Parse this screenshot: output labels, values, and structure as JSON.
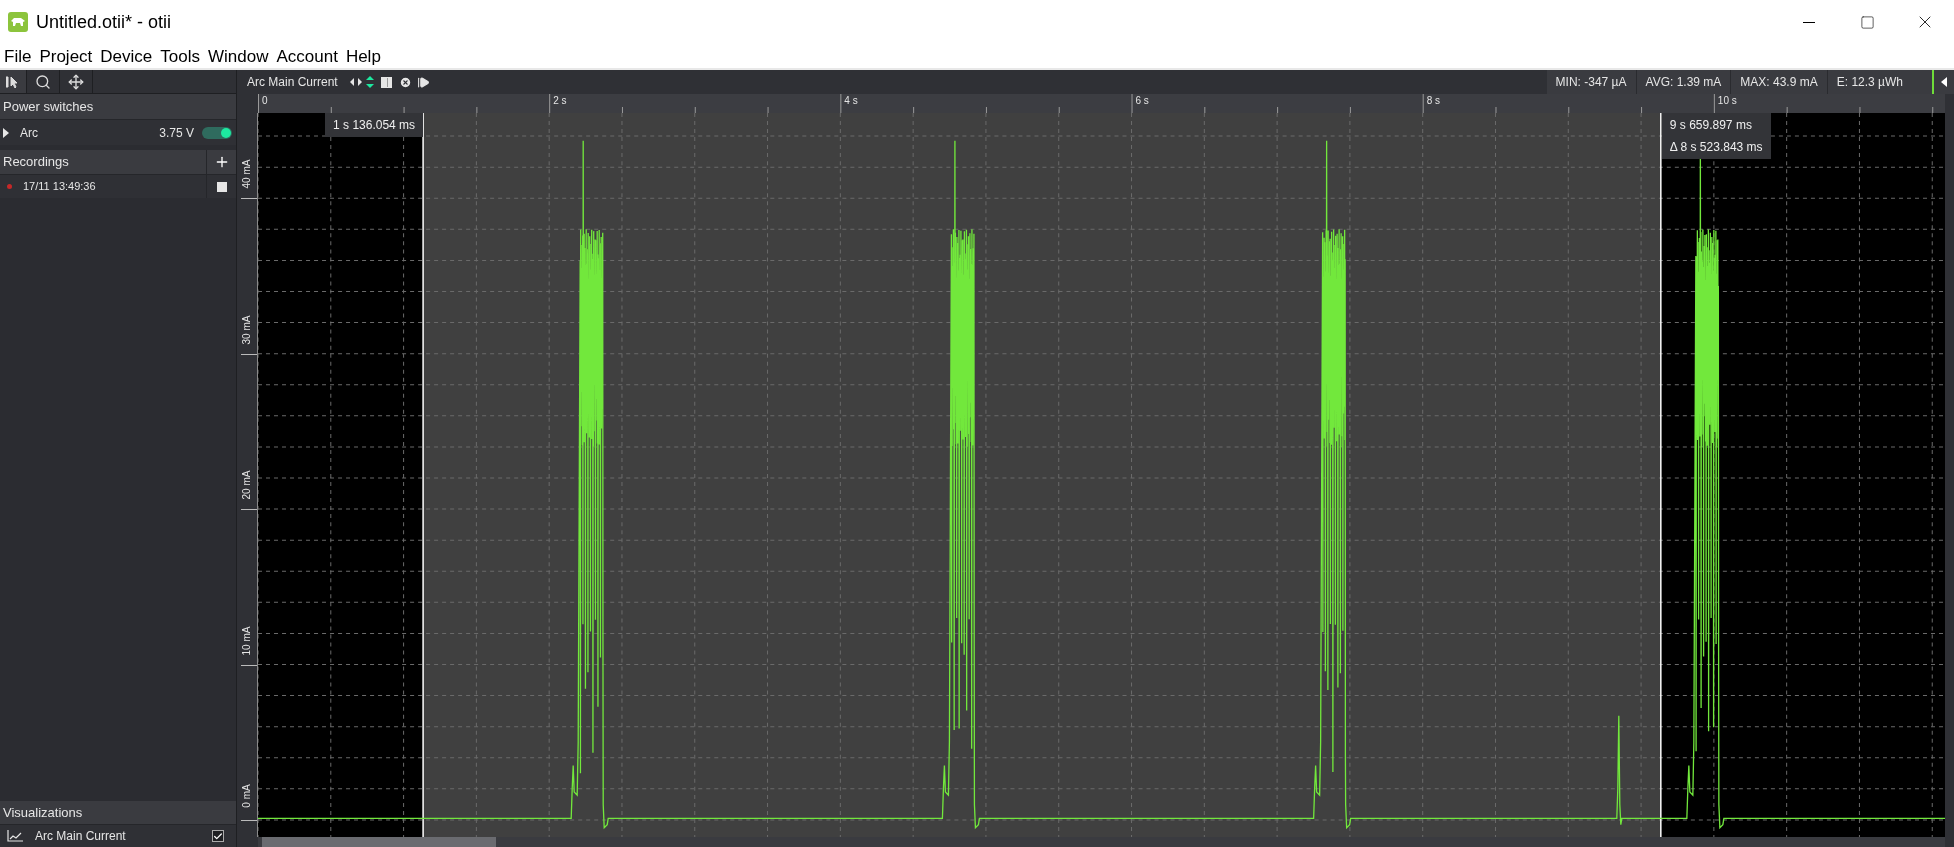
{
  "window": {
    "title": "Untitled.otii* - otii"
  },
  "menu": [
    "File",
    "Project",
    "Device",
    "Tools",
    "Window",
    "Account",
    "Help"
  ],
  "power_switches": {
    "title": "Power switches",
    "items": [
      {
        "name": "Arc",
        "expanded": false,
        "voltage": "3.75 V",
        "on": true
      }
    ]
  },
  "recordings": {
    "title": "Recordings",
    "items": [
      {
        "name": "17/11 13:49:36"
      }
    ]
  },
  "visualizations": {
    "title": "Visualizations",
    "items": [
      {
        "name": "Arc Main Current",
        "checked": true
      }
    ]
  },
  "plot": {
    "title": "Arc Main Current",
    "stats": [
      "MIN: -347 µA",
      "AVG: 1.39 mA",
      "MAX: 43.9 mA",
      "E: 12.3 µWh"
    ],
    "time_ticks": [
      "0",
      "2 s",
      "4 s",
      "6 s",
      "8 s",
      "10 s"
    ],
    "current_ticks": [
      "0 mA",
      "10 mA",
      "20 mA",
      "30 mA",
      "40 mA"
    ],
    "cursors": [
      {
        "time": "1 s 136.054 ms"
      },
      {
        "time": "9 s 659.897 ms",
        "delta": "Δ 8 s 523.843 ms"
      }
    ]
  }
}
